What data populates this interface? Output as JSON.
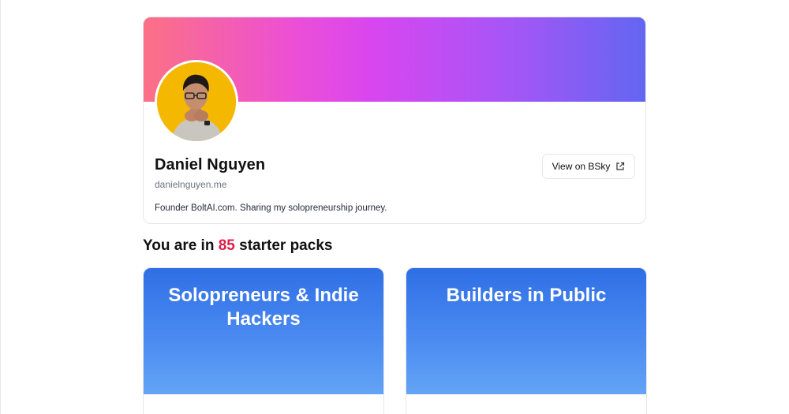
{
  "profile": {
    "name": "Daniel Nguyen",
    "handle": "danielnguyen.me",
    "bio": "Founder BoltAI.com. Sharing my solopreneurship journey.",
    "view_button_label": "View on BSky",
    "banner_colors": [
      "#fb7185",
      "#d946ef",
      "#a855f7",
      "#6366f1"
    ],
    "avatar_background": "#f5b800"
  },
  "summary": {
    "prefix": "You are in ",
    "count": "85",
    "suffix": " starter packs",
    "count_color": "#e11d48"
  },
  "starter_packs": [
    {
      "title": "Solopreneurs & Indie Hackers"
    },
    {
      "title": "Builders in Public"
    }
  ],
  "icons": {
    "external_link": "external-link-icon"
  }
}
